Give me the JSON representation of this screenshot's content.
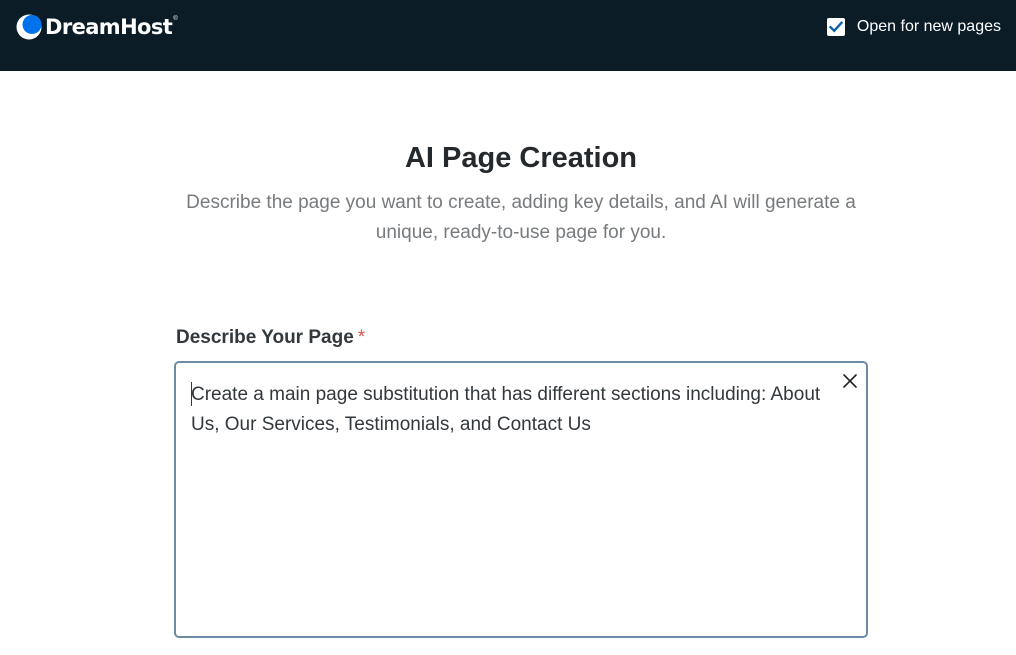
{
  "header": {
    "brand": "DreamHost",
    "brand_mark": "®",
    "open_new_pages_label": "Open for new pages",
    "open_new_pages_checked": true
  },
  "main": {
    "title": "AI Page Creation",
    "subtitle": "Describe the page you want to create, adding key details, and AI will generate a unique, ready-to-use page for you.",
    "field_label": "Describe Your Page",
    "required_marker": "*",
    "description_value": "Create a main page substitution that has different sections including: About Us, Our Services, Testimonials, and Contact Us"
  },
  "colors": {
    "header_bg": "#0b1c27",
    "brand_blue": "#0073ec",
    "checkbox_check": "#0b5fa8",
    "required": "#e0504f",
    "field_border": "#6d8ba7"
  },
  "icons": {
    "logo": "dreamhost-moon-icon",
    "checkbox": "checkmark-icon",
    "clear": "close-icon"
  }
}
